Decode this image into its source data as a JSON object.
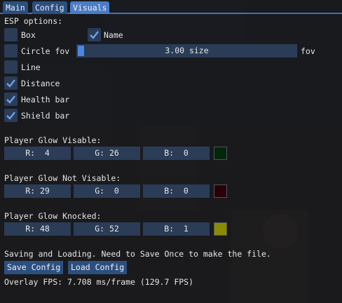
{
  "tabs": [
    "Main",
    "Config",
    "Visuals"
  ],
  "esp": {
    "title": "ESP options:",
    "box": "Box",
    "name": "Name",
    "circle_fov": "Circle fov",
    "slider_value": "3.00 size",
    "slider_fraction": 0.01,
    "slider_suffix": "fov",
    "line": "Line",
    "distance": "Distance",
    "health_bar": "Health bar",
    "shield_bar": "Shield bar"
  },
  "checked": {
    "box": false,
    "name": true,
    "circle_fov": false,
    "line": false,
    "distance": true,
    "health_bar": true,
    "shield_bar": true
  },
  "glow_visible": {
    "title": "Player Glow Visable:",
    "r": "R:  4",
    "g": "G: 26",
    "b": "B:  0",
    "color": "#04260a"
  },
  "glow_not_visible": {
    "title": "Player Glow Not Visable:",
    "r": "R: 29",
    "g": "G:  0",
    "b": "B:  0",
    "color": "#2a0008"
  },
  "glow_knocked": {
    "title": "Player Glow Knocked:",
    "r": "R: 48",
    "g": "G: 52",
    "b": "B:  1",
    "color": "#8a8c00"
  },
  "save": {
    "note": "Saving and Loading. Need to Save Once to make the file.",
    "save_label": "Save Config",
    "load_label": "Load Config"
  },
  "fps": "Overlay FPS: 7.708 ms/frame (129.7 FPS)",
  "colors": {
    "frame": "#2b3c57",
    "accent": "#4a7cc7",
    "check": "#6aa2f0"
  }
}
